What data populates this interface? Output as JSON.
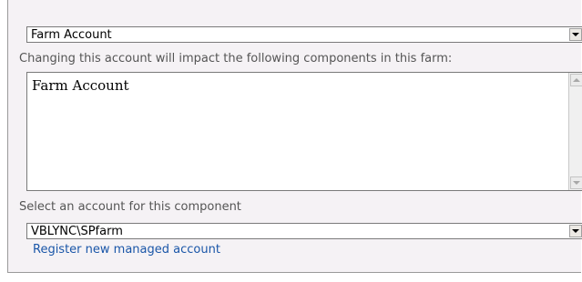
{
  "farm_account_select": {
    "selected": "Farm Account"
  },
  "components_label": "Changing this account will impact the following components in this farm:",
  "components_list": {
    "text": "Farm Account"
  },
  "account_label": "Select an account for this component",
  "account_select": {
    "selected": "VBLYNC\\SPfarm"
  },
  "register_link": "Register new managed account",
  "icons": {
    "dropdown": "chevron-down-icon",
    "scroll_up": "scroll-up-icon",
    "scroll_down": "scroll-down-icon"
  }
}
